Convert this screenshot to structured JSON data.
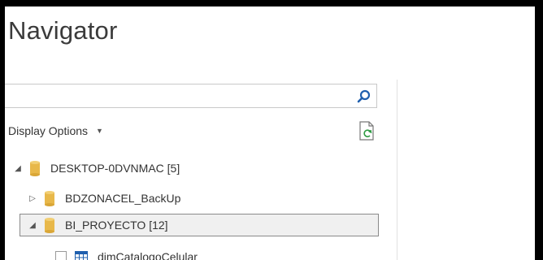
{
  "window": {
    "title": "Navigator"
  },
  "search": {
    "value": "",
    "placeholder": "",
    "icon": "search-icon"
  },
  "toolbar": {
    "display_options_label": "Display Options",
    "refresh_icon": "refresh-icon"
  },
  "tree": {
    "server": {
      "label": "DESKTOP-0DVNMAC [5]",
      "expanded": true
    },
    "databases": [
      {
        "label": "BDZONACEL_BackUp",
        "expanded": false,
        "selected": false
      },
      {
        "label": "BI_PROYECTO [12]",
        "expanded": true,
        "selected": true
      }
    ],
    "partial_item": {
      "label": "dimCatalogoCelular"
    }
  },
  "colors": {
    "db_icon": "#e8b84a",
    "selection_border": "#8a8a8a",
    "search_icon": "#1f5fae"
  }
}
